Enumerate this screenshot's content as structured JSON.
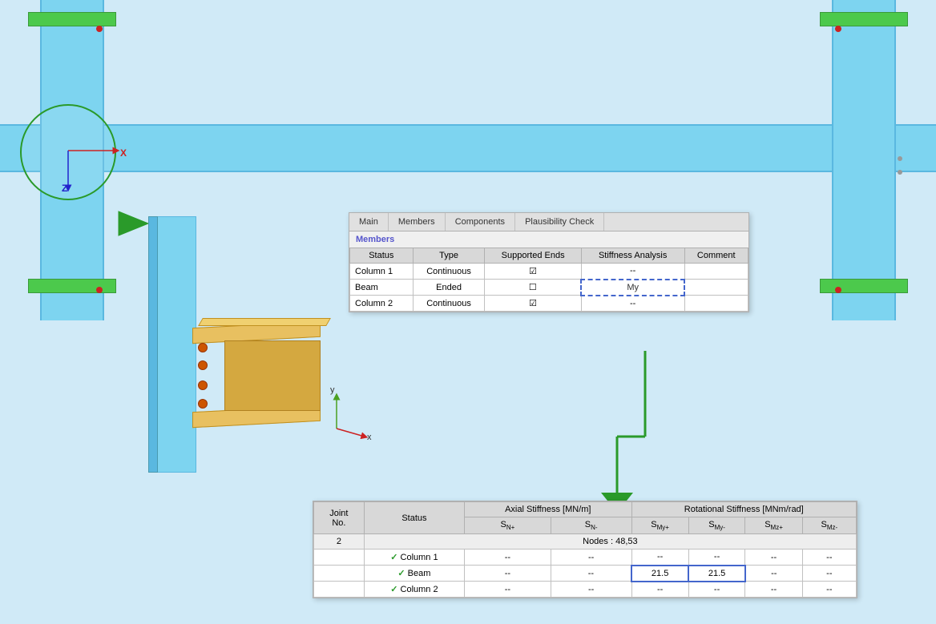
{
  "background": {
    "color": "#d0eaf7"
  },
  "tabs": {
    "items": [
      {
        "label": "Main",
        "active": false
      },
      {
        "label": "Members",
        "active": true
      },
      {
        "label": "Components",
        "active": false
      },
      {
        "label": "Plausibility Check",
        "active": false
      }
    ]
  },
  "members_section": {
    "title": "Members",
    "table": {
      "headers": [
        "Status",
        "Type",
        "Supported Ends",
        "Stiffness Analysis",
        "Comment"
      ],
      "rows": [
        {
          "status": "Column 1",
          "type": "Continuous",
          "supported_ends": true,
          "stiffness": "--",
          "comment": ""
        },
        {
          "status": "Beam",
          "type": "Ended",
          "supported_ends": false,
          "stiffness": "My",
          "comment": ""
        },
        {
          "status": "Column 2",
          "type": "Continuous",
          "supported_ends": true,
          "stiffness": "--",
          "comment": ""
        }
      ]
    }
  },
  "stiffness_section": {
    "table": {
      "headers_row1": [
        "Joint No.",
        "Status",
        "Axial Stiffness [MN/m]",
        "",
        "Rotational Stiffness [MNm/rad]",
        "",
        "",
        ""
      ],
      "headers_row2": [
        "",
        "",
        "SN+",
        "SN-",
        "SMy+",
        "SMy-",
        "SMz+",
        "SMz-"
      ],
      "rows": [
        {
          "joint": "2",
          "status": "Nodes : 48,53",
          "sn_plus": "",
          "sn_minus": "",
          "smy_plus": "",
          "smy_minus": "",
          "smz_plus": "",
          "smz_minus": "",
          "is_node": true
        },
        {
          "status": "Column 1",
          "sn_plus": "--",
          "sn_minus": "--",
          "smy_plus": "--",
          "smy_minus": "--",
          "smz_plus": "--",
          "smz_minus": "--",
          "check": true
        },
        {
          "status": "Beam",
          "sn_plus": "--",
          "sn_minus": "--",
          "smy_plus": "21.5",
          "smy_minus": "21.5",
          "smz_plus": "--",
          "smz_minus": "--",
          "check": true,
          "highlight_smy": true
        },
        {
          "status": "Column 2",
          "sn_plus": "--",
          "sn_minus": "--",
          "smy_plus": "--",
          "smy_minus": "--",
          "smz_plus": "--",
          "smz_minus": "--",
          "check": true
        }
      ]
    }
  },
  "axis": {
    "x_label": "X",
    "z_label": "Z",
    "y_label": "y",
    "x2_label": "x"
  },
  "colors": {
    "beam_blue": "#7dd4f0",
    "green_cap": "#4cc94c",
    "orange_flange": "#e8c060",
    "arrow_green": "#2a9a2a",
    "highlight_blue": "#4466cc"
  }
}
